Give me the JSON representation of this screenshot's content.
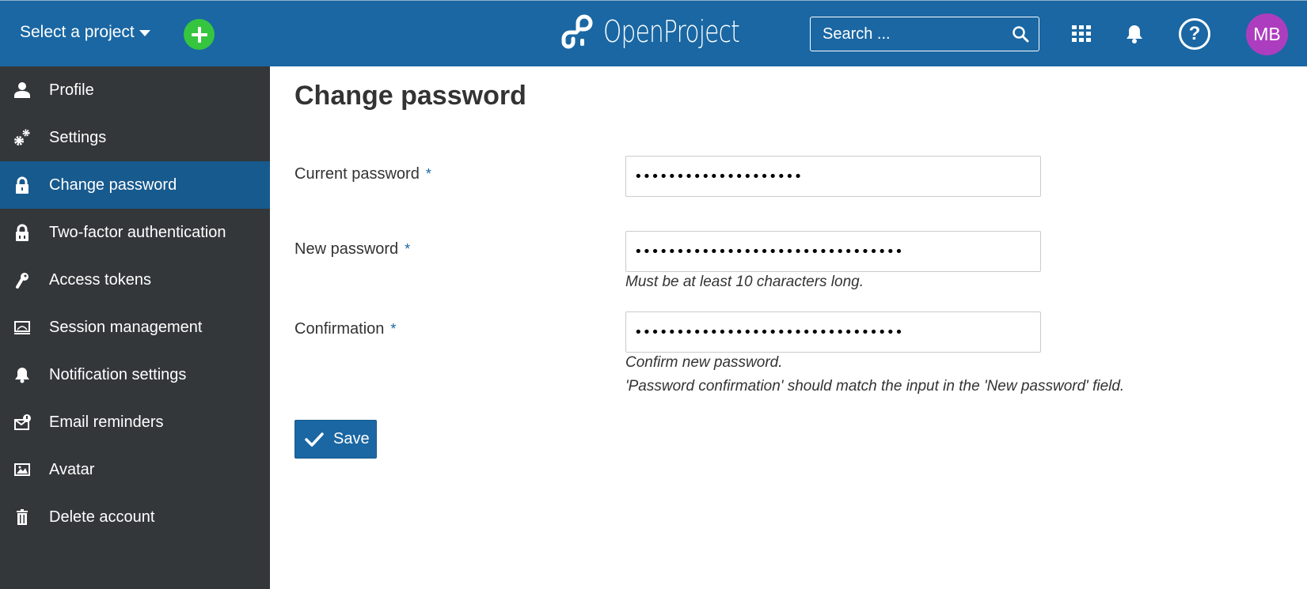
{
  "header": {
    "project_select_label": "Select a project",
    "add_button_icon": "plus-icon",
    "logo_text": "OpenProject",
    "search_placeholder": "Search ...",
    "avatar_initials": "MB",
    "colors": {
      "header_bg": "#1a67a3",
      "add_button": "#35c53f",
      "avatar": "#ad3dbf"
    }
  },
  "sidebar": {
    "items": [
      {
        "label": "Profile",
        "icon": "user-icon",
        "active": false
      },
      {
        "label": "Settings",
        "icon": "gears-icon",
        "active": false
      },
      {
        "label": "Change password",
        "icon": "lock-icon",
        "active": true
      },
      {
        "label": "Two-factor authentication",
        "icon": "two-factor-lock-icon",
        "active": false
      },
      {
        "label": "Access tokens",
        "icon": "key-icon",
        "active": false
      },
      {
        "label": "Session management",
        "icon": "session-monitor-icon",
        "active": false
      },
      {
        "label": "Notification settings",
        "icon": "bell-icon",
        "active": false
      },
      {
        "label": "Email reminders",
        "icon": "email-reminder-icon",
        "active": false
      },
      {
        "label": "Avatar",
        "icon": "image-icon",
        "active": false
      },
      {
        "label": "Delete account",
        "icon": "trash-icon",
        "active": false
      }
    ],
    "colors": {
      "bg": "#333739",
      "active_bg": "#175a8e"
    }
  },
  "main": {
    "title": "Change password",
    "fields": [
      {
        "label": "Current password",
        "required_mark": "*",
        "value": "••••••••••••••••••••",
        "hints": []
      },
      {
        "label": "New password",
        "required_mark": "*",
        "value": "••••••••••••••••••••••••••••••••",
        "hints": [
          "Must be at least 10 characters long."
        ]
      },
      {
        "label": "Confirmation",
        "required_mark": "*",
        "value": "••••••••••••••••••••••••••••••••",
        "hints": [
          "Confirm new password.",
          "'Password confirmation' should match the input in the 'New password' field."
        ]
      }
    ],
    "save_label": "Save"
  }
}
